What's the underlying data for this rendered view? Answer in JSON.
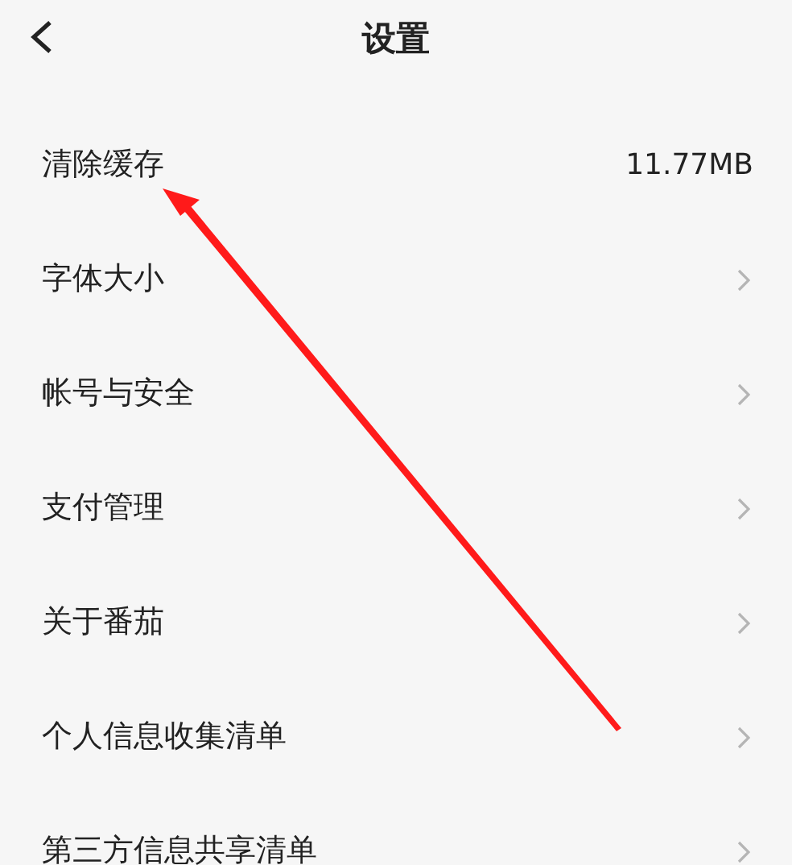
{
  "header": {
    "title": "设置"
  },
  "rows": [
    {
      "label": "清除缓存",
      "kind": "value",
      "value": "11.77MB"
    },
    {
      "label": "字体大小",
      "kind": "link"
    },
    {
      "label": "帐号与安全",
      "kind": "link"
    },
    {
      "label": "支付管理",
      "kind": "link"
    },
    {
      "label": "关于番茄",
      "kind": "link"
    },
    {
      "label": "个人信息收集清单",
      "kind": "link"
    },
    {
      "label": "第三方信息共享清单",
      "kind": "link"
    }
  ]
}
